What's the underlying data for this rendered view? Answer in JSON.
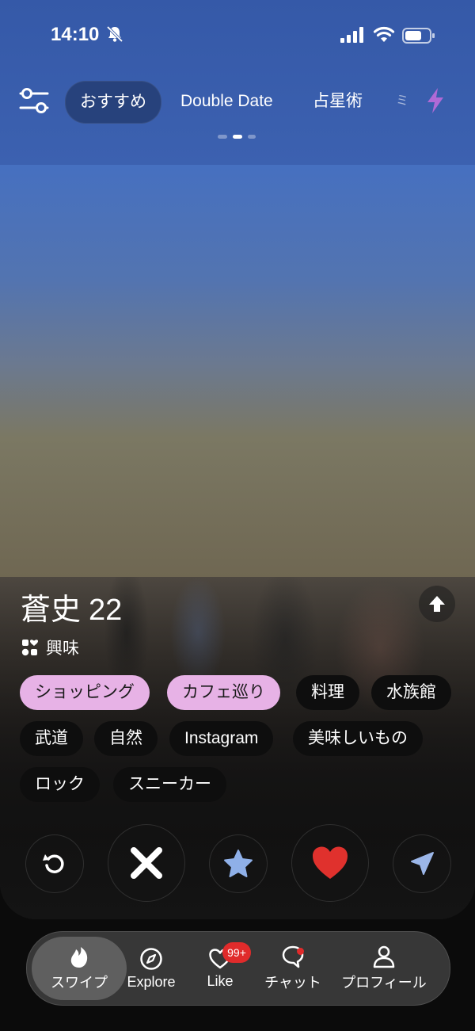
{
  "status_bar": {
    "time": "14:10",
    "icons": [
      "bell-slash-icon",
      "cellular-signal-icon",
      "wifi-icon",
      "battery-icon"
    ]
  },
  "top_tabs": {
    "items": [
      {
        "label": "おすすめ",
        "active": true
      },
      {
        "label": "Double Date",
        "active": false
      },
      {
        "label": "占星術",
        "active": false
      },
      {
        "label": "ミ",
        "active": false
      }
    ],
    "filter_icon": "filter-sliders-icon",
    "boost_icon": "lightning-bolt-icon",
    "boost_color": "#b06ad6",
    "page_indicator": {
      "count": 3,
      "current": 2
    }
  },
  "profile": {
    "name": "蒼史",
    "age": "22",
    "interests_label": "興味",
    "interests_icon": "shapes-heart-icon",
    "tags": [
      {
        "label": "ショッピング",
        "highlighted": true
      },
      {
        "label": "カフェ巡り",
        "highlighted": true
      },
      {
        "label": "料理",
        "highlighted": false
      },
      {
        "label": "水族館",
        "highlighted": false
      },
      {
        "label": "武道",
        "highlighted": false
      },
      {
        "label": "自然",
        "highlighted": false
      },
      {
        "label": "Instagram",
        "highlighted": false
      },
      {
        "label": "美味しいもの",
        "highlighted": false
      },
      {
        "label": "ロック",
        "highlighted": false
      },
      {
        "label": "スニーカー",
        "highlighted": false
      }
    ]
  },
  "actions": [
    {
      "name": "rewind",
      "icon": "rewind-icon"
    },
    {
      "name": "nope",
      "icon": "x-icon"
    },
    {
      "name": "super-like",
      "icon": "star-icon",
      "color": "#8fb0e8"
    },
    {
      "name": "like",
      "icon": "heart-icon",
      "color": "#e0312d"
    },
    {
      "name": "send",
      "icon": "paper-plane-icon",
      "color": "#9bb6e8"
    }
  ],
  "bottom_nav": {
    "items": [
      {
        "label": "スワイプ",
        "icon": "flame-icon",
        "active": true
      },
      {
        "label": "Explore",
        "icon": "compass-icon",
        "active": false
      },
      {
        "label": "Like",
        "icon": "heart-outline-icon",
        "active": false,
        "badge": "99+"
      },
      {
        "label": "チャット",
        "icon": "chat-bubble-icon",
        "active": false,
        "dot": true
      },
      {
        "label": "プロフィール",
        "icon": "person-icon",
        "active": false
      }
    ],
    "badge_color": "#e02b2b"
  }
}
